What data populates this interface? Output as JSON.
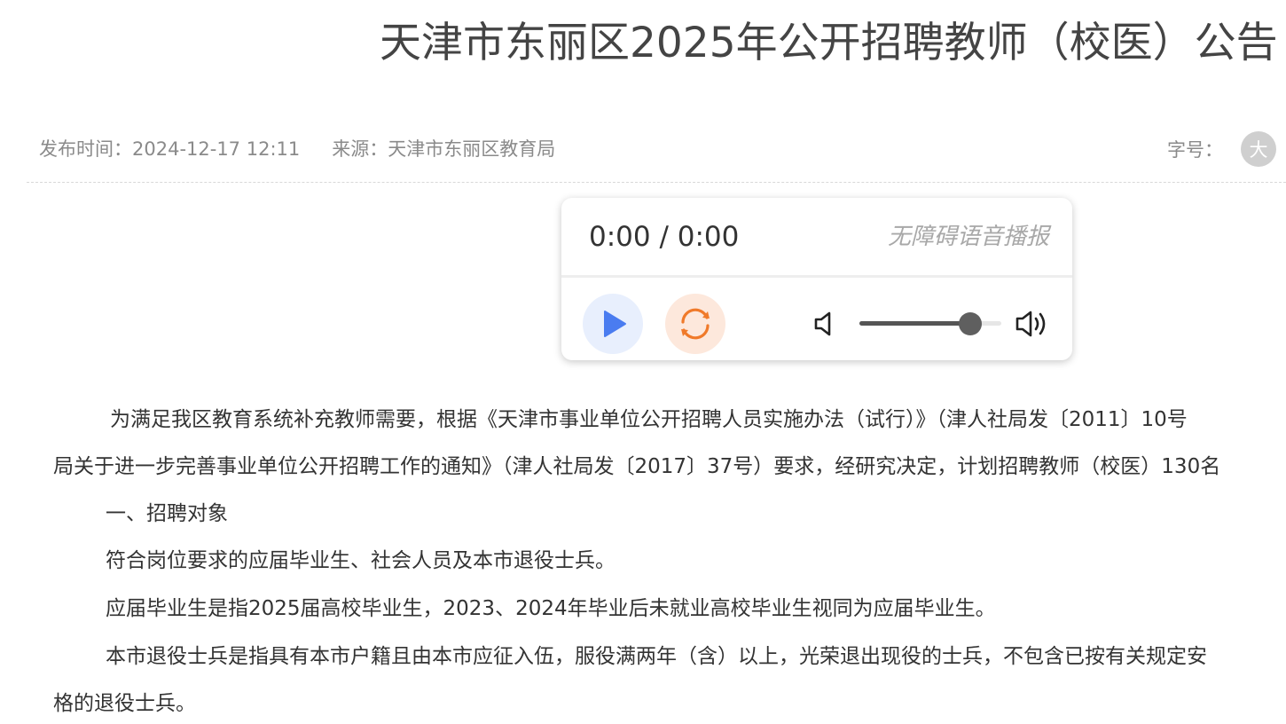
{
  "article": {
    "title": "天津市东丽区2025年公开招聘教师（校医）公告",
    "publish_time": "发布时间：2024-12-17 12:11",
    "source": "来源：天津市东丽区教育局",
    "font_size_label": "字号：",
    "font_size_large": "大"
  },
  "player": {
    "time": "0:00 / 0:00",
    "label": "无障碍语音播报",
    "volume": 0.78,
    "icons": [
      "play-icon",
      "replay-icon",
      "volume-low-icon",
      "volume-high-icon"
    ],
    "colors": {
      "play": "#4a7cf0",
      "replay": "#f07a2a"
    }
  },
  "body": {
    "para1_line1": "为满足我区教育系统补充教师需要，根据《天津市事业单位公开招聘人员实施办法（试行）》（津人社局发〔2011〕10号",
    "para1_line2": "局关于进一步完善事业单位公开招聘工作的通知》（津人社局发〔2017〕37号）要求，经研究决定，计划招聘教师（校医）130名",
    "heading1": "一、招聘对象",
    "para2": "符合岗位要求的应届毕业生、社会人员及本市退役士兵。",
    "para3": "应届毕业生是指2025届高校毕业生，2023、2024年毕业后未就业高校毕业生视同为应届毕业生。",
    "para4_line1": "本市退役士兵是指具有本市户籍且由本市应征入伍，服役满两年（含）以上，光荣退出现役的士兵，不包含已按有关规定安",
    "para4_line2": "格的退役士兵。"
  }
}
